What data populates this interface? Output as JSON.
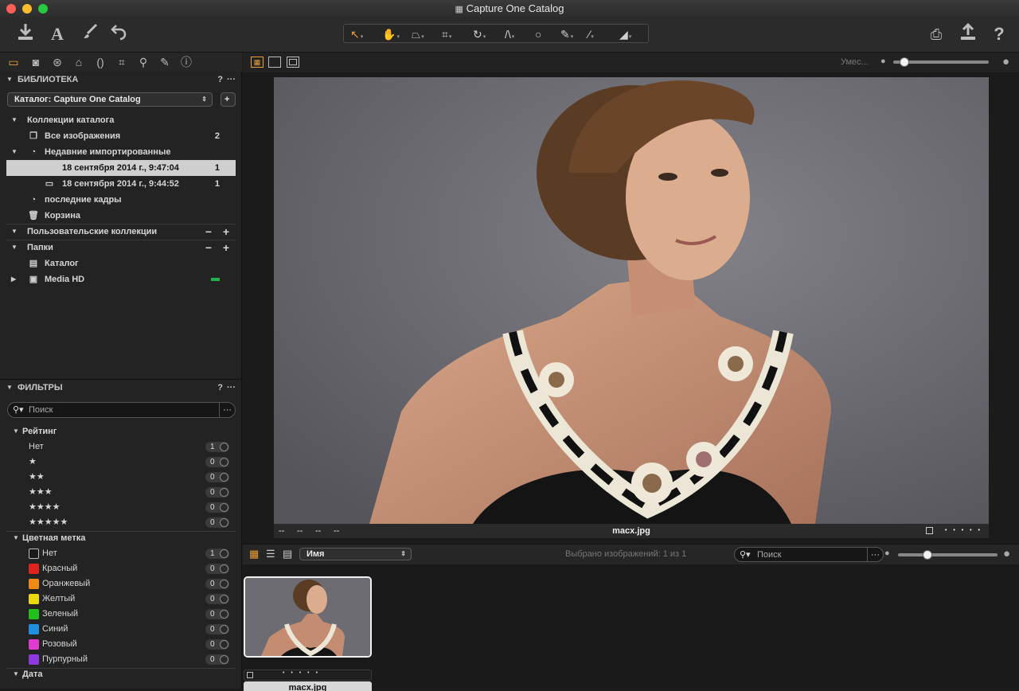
{
  "window": {
    "title": "Capture One Catalog"
  },
  "toolbar": {
    "left_icons": [
      "import-icon",
      "text-icon",
      "brush-icon",
      "undo-icon"
    ],
    "tools": [
      "cursor-icon",
      "hand-icon",
      "keystone-icon",
      "crop-icon",
      "rotate-icon",
      "straighten-icon",
      "circle-icon",
      "brush-tool-icon",
      "eyedropper-icon",
      "eraser-icon"
    ],
    "right_icons": [
      "print-icon",
      "export-icon",
      "help-icon"
    ]
  },
  "library": {
    "header": "БИБЛИОТЕКА",
    "help": "?",
    "more": "···",
    "catalog_select": "Каталог: Capture One Catalog",
    "add_symbol": "+",
    "catalog_collections": "Коллекции каталога",
    "all_images": {
      "label": "Все изображения",
      "count": "2"
    },
    "recent_imports": "Недавние импортированные",
    "imports": [
      {
        "label": "18 сентября 2014 г., 9:47:04",
        "count": "1"
      },
      {
        "label": "18 сентября 2014 г., 9:44:52",
        "count": "1"
      }
    ],
    "recent_captures": "последние кадры",
    "trash": "Корзина",
    "user_collections": "Пользовательские коллекции",
    "folders": "Папки",
    "catalog": "Каталог",
    "media": "Media HD"
  },
  "filters": {
    "header": "ФИЛЬТРЫ",
    "help": "?",
    "more": "···",
    "search_placeholder": "Поиск",
    "rating_header": "Рейтинг",
    "ratings": [
      {
        "label": "Нет",
        "count": "1"
      },
      {
        "label": "★",
        "count": "0"
      },
      {
        "label": "★★",
        "count": "0"
      },
      {
        "label": "★★★",
        "count": "0"
      },
      {
        "label": "★★★★",
        "count": "0"
      },
      {
        "label": "★★★★★",
        "count": "0"
      }
    ],
    "color_header": "Цветная метка",
    "colors": [
      {
        "label": "Нет",
        "count": "1",
        "color": "#1a1a1a"
      },
      {
        "label": "Красный",
        "count": "0",
        "color": "#e0241d"
      },
      {
        "label": "Оранжевый",
        "count": "0",
        "color": "#f08a12"
      },
      {
        "label": "Желтый",
        "count": "0",
        "color": "#ecd90d"
      },
      {
        "label": "Зеленый",
        "count": "0",
        "color": "#22c01a"
      },
      {
        "label": "Синий",
        "count": "0",
        "color": "#1e8fe0"
      },
      {
        "label": "Розовый",
        "count": "0",
        "color": "#e03bd0"
      },
      {
        "label": "Пурпурный",
        "count": "0",
        "color": "#8f38e0"
      }
    ],
    "date_header": "Дата"
  },
  "viewer": {
    "zoom_label": "Умес...",
    "caption_filename": "macx.jpg",
    "caption_left": [
      "--",
      "--",
      "--",
      "--"
    ],
    "caption_dots": "• • • • •"
  },
  "browser": {
    "sort_select": "Имя",
    "selected_text": "Выбрано изображений: 1 из 1",
    "search_placeholder": "Поиск",
    "more": "···",
    "thumb_filename": "macx.jpg",
    "thumb_dots": "• • • • •"
  },
  "colors": {
    "accent": "#e9a03b",
    "status_green": "#23b14d"
  }
}
